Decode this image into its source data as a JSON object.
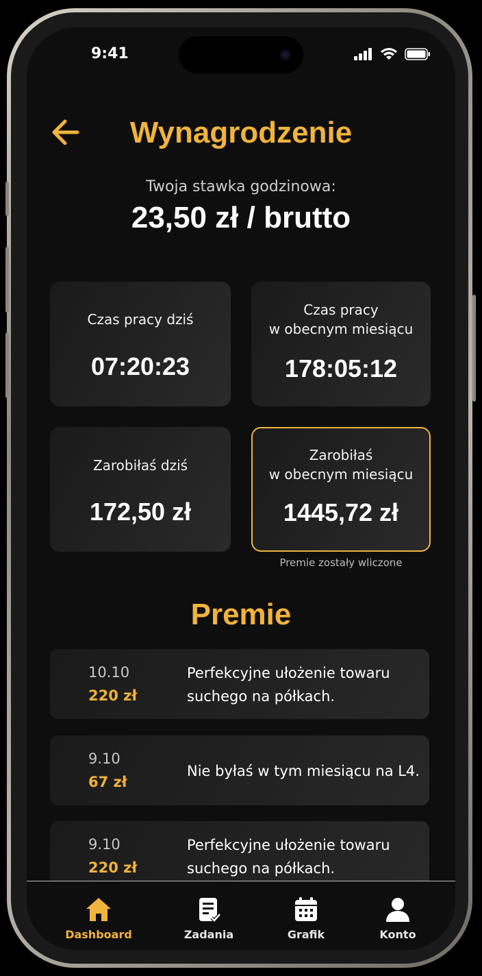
{
  "status": {
    "time": "9:41"
  },
  "header": {
    "title": "Wynagrodzenie"
  },
  "rate": {
    "label": "Twoja stawka godzinowa:",
    "value": "23,50 zł / brutto"
  },
  "stats": {
    "work_today": {
      "label": "Czas pracy dziś",
      "value": "07:20:23"
    },
    "work_month": {
      "label_line1": "Czas pracy",
      "label_line2": "w obecnym miesiącu",
      "value": "178:05:12"
    },
    "earned_today": {
      "label": "Zarobiłaś dziś",
      "value": "172,50 zł"
    },
    "earned_month": {
      "label_line1": "Zarobiłaś",
      "label_line2": "w obecnym miesiącu",
      "value": "1445,72 zł",
      "note": "Premie zostały wliczone"
    }
  },
  "bonuses": {
    "title": "Premie",
    "items": [
      {
        "date": "10.10",
        "amount": "220 zł",
        "description": "Perfekcyjne ułożenie towaru suchego na półkach."
      },
      {
        "date": "9.10",
        "amount": "67 zł",
        "description": "Nie byłaś w tym miesiącu na L4."
      },
      {
        "date": "9.10",
        "amount": "220 zł",
        "description": "Perfekcyjne ułożenie towaru suchego na półkach."
      }
    ]
  },
  "tabbar": {
    "items": [
      {
        "label": "Dashboard",
        "icon": "home-icon",
        "active": true
      },
      {
        "label": "Zadania",
        "icon": "tasks-icon",
        "active": false
      },
      {
        "label": "Grafik",
        "icon": "calendar-icon",
        "active": false
      },
      {
        "label": "Konto",
        "icon": "user-icon",
        "active": false
      }
    ]
  },
  "colors": {
    "accent": "#f0b33c",
    "background": "#0e0e0e",
    "card": "#222222"
  }
}
